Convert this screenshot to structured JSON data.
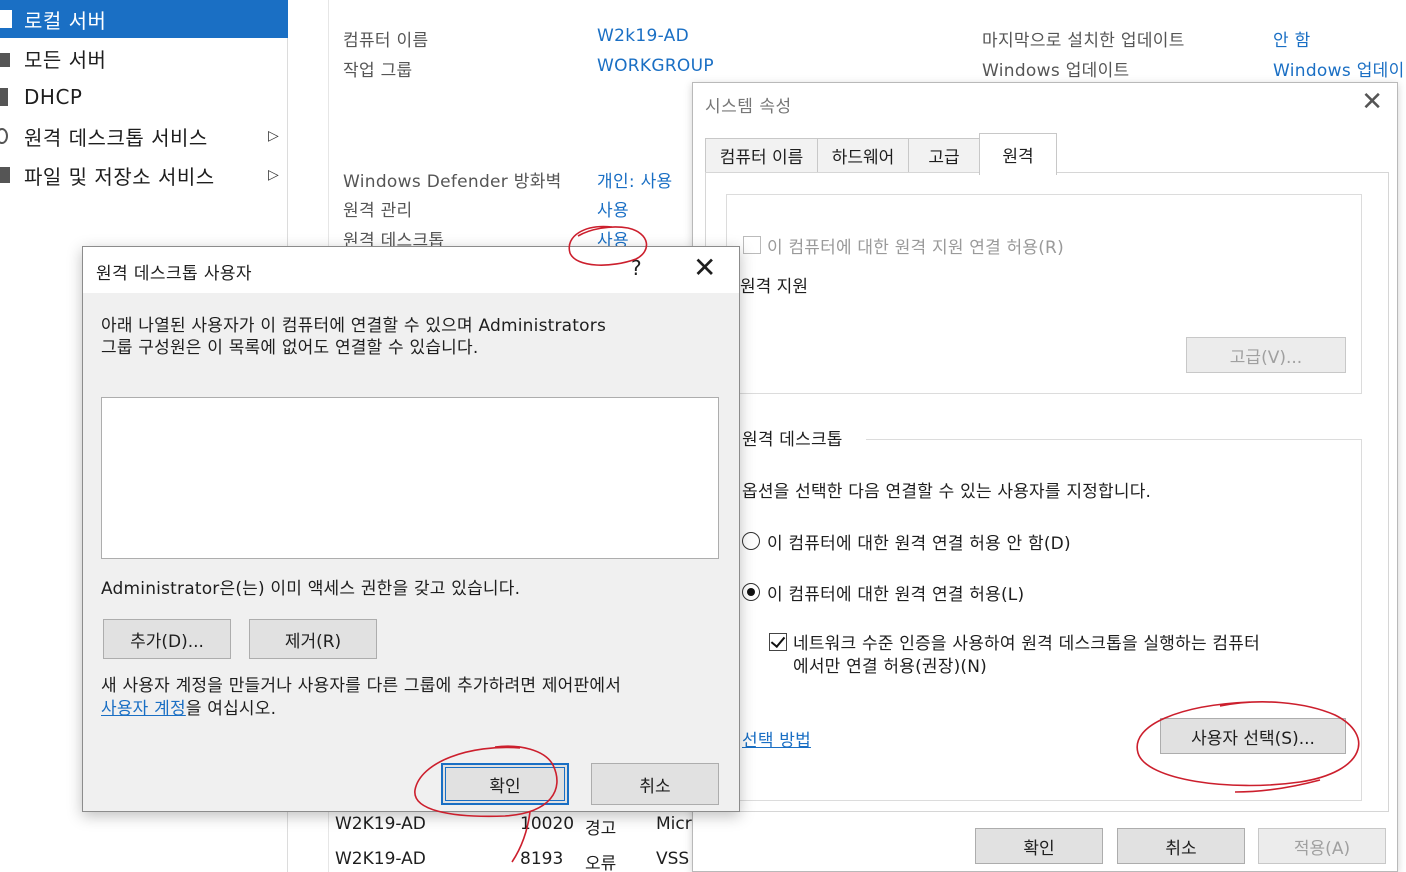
{
  "nav": {
    "items": [
      {
        "label": "로컬 서버",
        "icon": "server-icon",
        "selected": true
      },
      {
        "label": "모든 서버",
        "icon": "servers-icon"
      },
      {
        "label": "DHCP",
        "icon": "dhcp-icon"
      },
      {
        "label": "원격 데스크톱 서비스",
        "icon": "remote-desktop-icon",
        "arrow": "▷"
      },
      {
        "label": "파일 및 저장소 서비스",
        "icon": "storage-icon",
        "arrow": "▷"
      }
    ]
  },
  "properties": {
    "computer_name_label": "컴퓨터 이름",
    "computer_name_value": "W2k19-AD",
    "workgroup_label": "작업 그룹",
    "workgroup_value": "WORKGROUP",
    "last_update_label": "마지막으로 설치한 업데이트",
    "last_update_value": "안 함",
    "windows_update_label": "Windows 업데이트",
    "windows_update_value": "Windows 업데이",
    "firewall_label": "Windows Defender 방화벽",
    "firewall_value": "개인: 사용",
    "remote_mgmt_label": "원격 관리",
    "remote_mgmt_value": "사용",
    "remote_desktop_label": "원격 데스크톱",
    "remote_desktop_value": "사용"
  },
  "events": {
    "rows": [
      {
        "server": "W2K19-AD",
        "id": "10020",
        "level": "경고",
        "source": "Micr"
      },
      {
        "server": "W2K19-AD",
        "id": "8193",
        "level": "오류",
        "source": "VSS"
      }
    ]
  },
  "system_properties": {
    "title": "시스템 속성",
    "close": "✕",
    "tabs": [
      "컴퓨터 이름",
      "하드웨어",
      "고급",
      "원격"
    ],
    "remote_assistance": {
      "group_title": "원격 지원",
      "checkbox_label": "이 컴퓨터에 대한 원격 지원 연결 허용(R)",
      "advanced_button": "고급(V)..."
    },
    "remote_desktop": {
      "group_title": "원격 데스크톱",
      "description": "옵션을 선택한 다음 연결할 수 있는 사용자를 지정합니다.",
      "radio_deny": "이 컴퓨터에 대한 원격 연결 허용 안 함(D)",
      "radio_allow": "이 컴퓨터에 대한 원격 연결 허용(L)",
      "nla_line1": "네트워크 수준 인증을 사용하여 원격 데스크톱을 실행하는 컴퓨터",
      "nla_line2": "에서만 연결 허용(권장)(N)",
      "help_link": "선택 방법",
      "select_users_button": "사용자 선택(S)..."
    },
    "buttons": {
      "ok": "확인",
      "cancel": "취소",
      "apply": "적용(A)"
    }
  },
  "rdu_dialog": {
    "title": "원격 데스크톱 사용자",
    "help": "?",
    "close": "✕",
    "description_line1": "아래 나열된 사용자가 이 컴퓨터에 연결할 수 있으며 Administrators",
    "description_line2": "그룹 구성원은 이 목록에 없어도 연결할 수 있습니다.",
    "access_note": "Administrator은(는) 이미 액세스 권한을 갖고 있습니다.",
    "add_button": "추가(D)...",
    "remove_button": "제거(R)",
    "footer_line1": "새 사용자 계정을 만들거나 사용자를 다른 그룹에 추가하려면 제어판에서",
    "footer_link": "사용자 계정",
    "footer_suffix": "을 여십시오.",
    "ok_button": "확인",
    "cancel_button": "취소"
  },
  "colors": {
    "accent": "#1a6fc4",
    "annotation": "#cc1f2d"
  }
}
